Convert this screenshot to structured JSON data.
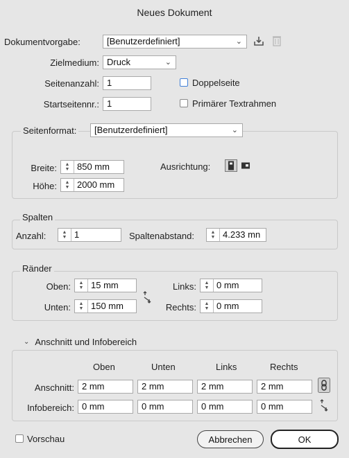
{
  "window": {
    "title": "Neues Dokument"
  },
  "document": {
    "preset_label": "Dokumentvorgabe:",
    "preset_value": "[Benutzerdefiniert]",
    "intent_label": "Zielmedium:",
    "intent_value": "Druck",
    "pages_label": "Seitenanzahl:",
    "pages_value": "1",
    "start_label": "Startseitennr.:",
    "start_value": "1",
    "facing_label": "Doppelseite",
    "primary_frame_label": "Primärer Textrahmen"
  },
  "page_size": {
    "label": "Seitenformat:",
    "value": "[Benutzerdefiniert]",
    "width_label": "Breite:",
    "width_value": "850 mm",
    "height_label": "Höhe:",
    "height_value": "2000 mm",
    "orientation_label": "Ausrichtung:"
  },
  "columns": {
    "title": "Spalten",
    "count_label": "Anzahl:",
    "count_value": "1",
    "gutter_label": "Spaltenabstand:",
    "gutter_value": "4.233 mn"
  },
  "margins": {
    "title": "Ränder",
    "top_label": "Oben:",
    "top_value": "15 mm",
    "bottom_label": "Unten:",
    "bottom_value": "150 mm",
    "left_label": "Links:",
    "left_value": "0 mm",
    "right_label": "Rechts:",
    "right_value": "0 mm"
  },
  "bleed_slug": {
    "title": "Anschnitt und Infobereich",
    "headers": [
      "Oben",
      "Unten",
      "Links",
      "Rechts"
    ],
    "bleed_label": "Anschnitt:",
    "bleed_values": [
      "2 mm",
      "2 mm",
      "2 mm",
      "2 mm"
    ],
    "slug_label": "Infobereich:",
    "slug_values": [
      "0 mm",
      "0 mm",
      "0 mm",
      "0 mm"
    ]
  },
  "footer": {
    "preview_label": "Vorschau",
    "cancel_label": "Abbrechen",
    "ok_label": "OK"
  },
  "colors": {
    "dialog_bg": "#e6e6e6",
    "checkbox_focus": "#3f7fd8"
  }
}
